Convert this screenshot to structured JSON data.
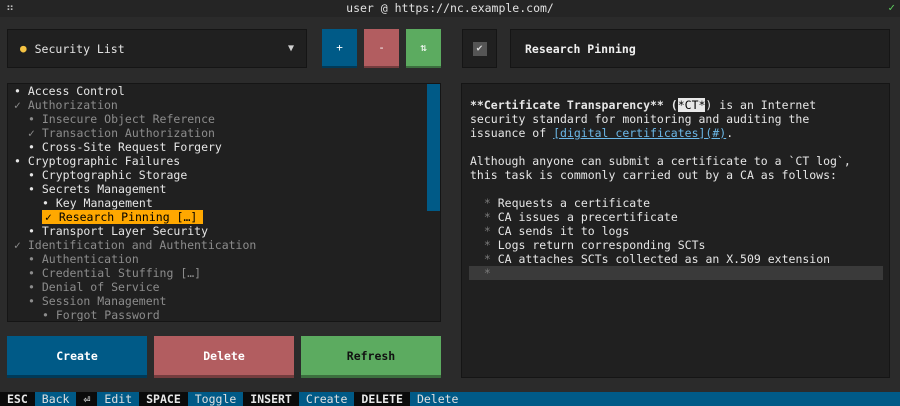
{
  "window": {
    "title": "user @ https://nc.example.com/",
    "app_icon": "⠶",
    "status_check": "✓"
  },
  "list_selector": {
    "label": "Security List",
    "dot": "●",
    "caret": "▼"
  },
  "toolbar": {
    "add": "+",
    "remove": "-",
    "sort": "⇅"
  },
  "item": {
    "done_check": "✔",
    "title": "Research Pinning"
  },
  "tree": [
    {
      "text": "• Access Control",
      "indent": 0,
      "state": "normal"
    },
    {
      "text": "✓ Authorization",
      "indent": 0,
      "state": "done"
    },
    {
      "text": "• Insecure Object Reference",
      "indent": 1,
      "state": "done"
    },
    {
      "text": "✓ Transaction Authorization",
      "indent": 1,
      "state": "done"
    },
    {
      "text": "• Cross-Site Request Forgery",
      "indent": 1,
      "state": "normal"
    },
    {
      "text": "• Cryptographic Failures",
      "indent": 0,
      "state": "normal"
    },
    {
      "text": "• Cryptographic Storage",
      "indent": 1,
      "state": "normal"
    },
    {
      "text": "• Secrets Management",
      "indent": 1,
      "state": "normal"
    },
    {
      "text": "• Key Management",
      "indent": 2,
      "state": "normal"
    },
    {
      "text": "✓ Research Pinning […]",
      "indent": 2,
      "state": "selected"
    },
    {
      "text": "• Transport Layer Security",
      "indent": 1,
      "state": "normal"
    },
    {
      "text": "✓ Identification and Authentication",
      "indent": 0,
      "state": "done"
    },
    {
      "text": "• Authentication",
      "indent": 1,
      "state": "done"
    },
    {
      "text": "• Credential Stuffing […]",
      "indent": 1,
      "state": "done"
    },
    {
      "text": "• Denial of Service",
      "indent": 1,
      "state": "done"
    },
    {
      "text": "• Session Management",
      "indent": 1,
      "state": "done"
    },
    {
      "text": "• Forgot Password",
      "indent": 2,
      "state": "done"
    }
  ],
  "detail": {
    "p1_a": "**Certificate Transparency** (",
    "p1_hl": "*CT*",
    "p1_b": ") is an Internet",
    "p1_line2": "security standard for monitoring and auditing the",
    "p1_line3_a": "issuance of ",
    "p1_link": "[digital certificates](#)",
    "p1_line3_b": ".",
    "p2_line1": "Although anyone can submit a certificate to a `CT log`,",
    "p2_line2": "this task is commonly carried out by a CA as follows:",
    "bullet_mark": "*",
    "bullets": [
      "Requests a certificate",
      "CA issues a precertificate",
      "CA sends it to logs",
      "Logs return corresponding SCTs",
      "CA attaches SCTs collected as an X.509 extension"
    ],
    "cursor_bullet": "*"
  },
  "actions": {
    "create": "Create",
    "delete": "Delete",
    "refresh": "Refresh"
  },
  "statusbar": [
    {
      "key": "ESC",
      "action": "Back"
    },
    {
      "key": "⏎",
      "action": "Edit"
    },
    {
      "key": "SPACE",
      "action": "Toggle"
    },
    {
      "key": "INSERT",
      "action": "Create"
    },
    {
      "key": "DELETE",
      "action": "Delete"
    }
  ]
}
